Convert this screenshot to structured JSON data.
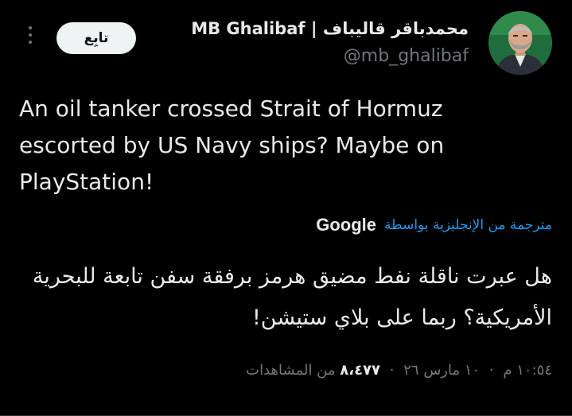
{
  "author": {
    "display_name": "MB Ghalibaf | محمدباقر قالیباف",
    "handle": "@mb_ghalibaf",
    "avatar_icon": "profile-photo"
  },
  "actions": {
    "follow_label": "تابِع",
    "more_icon": "ellipsis-vertical-icon"
  },
  "tweet": {
    "text": "An oil tanker crossed Strait of Hormuz escorted by US Navy ships? Maybe on PlayStation!",
    "translated_label": "مترجمة من الإنجليزية بواسطة",
    "translator_name": "Google",
    "translation": "هل عبرت ناقلة نفط مضيق هرمز برفقة سفن تابعة للبحرية الأمريكية؟ ربما على بلاي ستيشن!"
  },
  "meta": {
    "time": "١٠:٥٤ م",
    "separator": "·",
    "date": "١٠ مارس ٢٦",
    "views_count": "٨،٤٧٧",
    "views_label": "من المشاهدات"
  },
  "colors": {
    "background": "#000000",
    "text_primary": "#e7e9ea",
    "text_secondary": "#71767b",
    "link": "#1d9bf0",
    "follow_bg": "#eff3f4"
  }
}
